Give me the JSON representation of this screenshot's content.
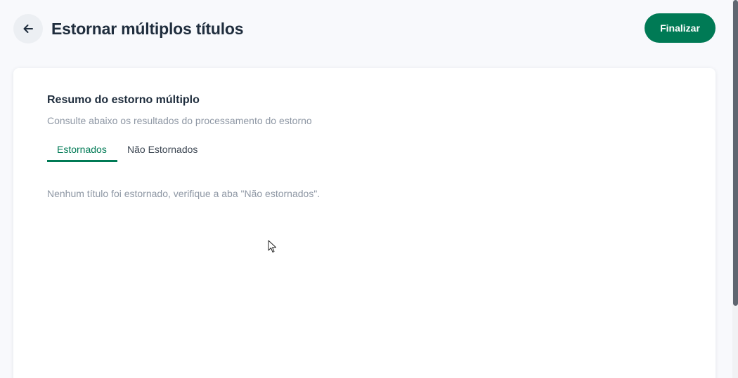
{
  "header": {
    "title": "Estornar múltiplos títulos",
    "back_icon": "arrow-left-icon",
    "finalize_label": "Finalizar"
  },
  "summary": {
    "title": "Resumo do estorno múltiplo",
    "subtitle": "Consulte abaixo os resultados do processamento do estorno",
    "tabs": [
      {
        "label": "Estornados",
        "active": true
      },
      {
        "label": "Não Estornados",
        "active": false
      }
    ],
    "empty_message": "Nenhum título foi estornado, verifique a aba \"Não estornados\"."
  },
  "colors": {
    "accent": "#007a55",
    "title_text": "#1f2d3d",
    "muted_text": "#8e97a4",
    "background": "#f8f9fc"
  }
}
